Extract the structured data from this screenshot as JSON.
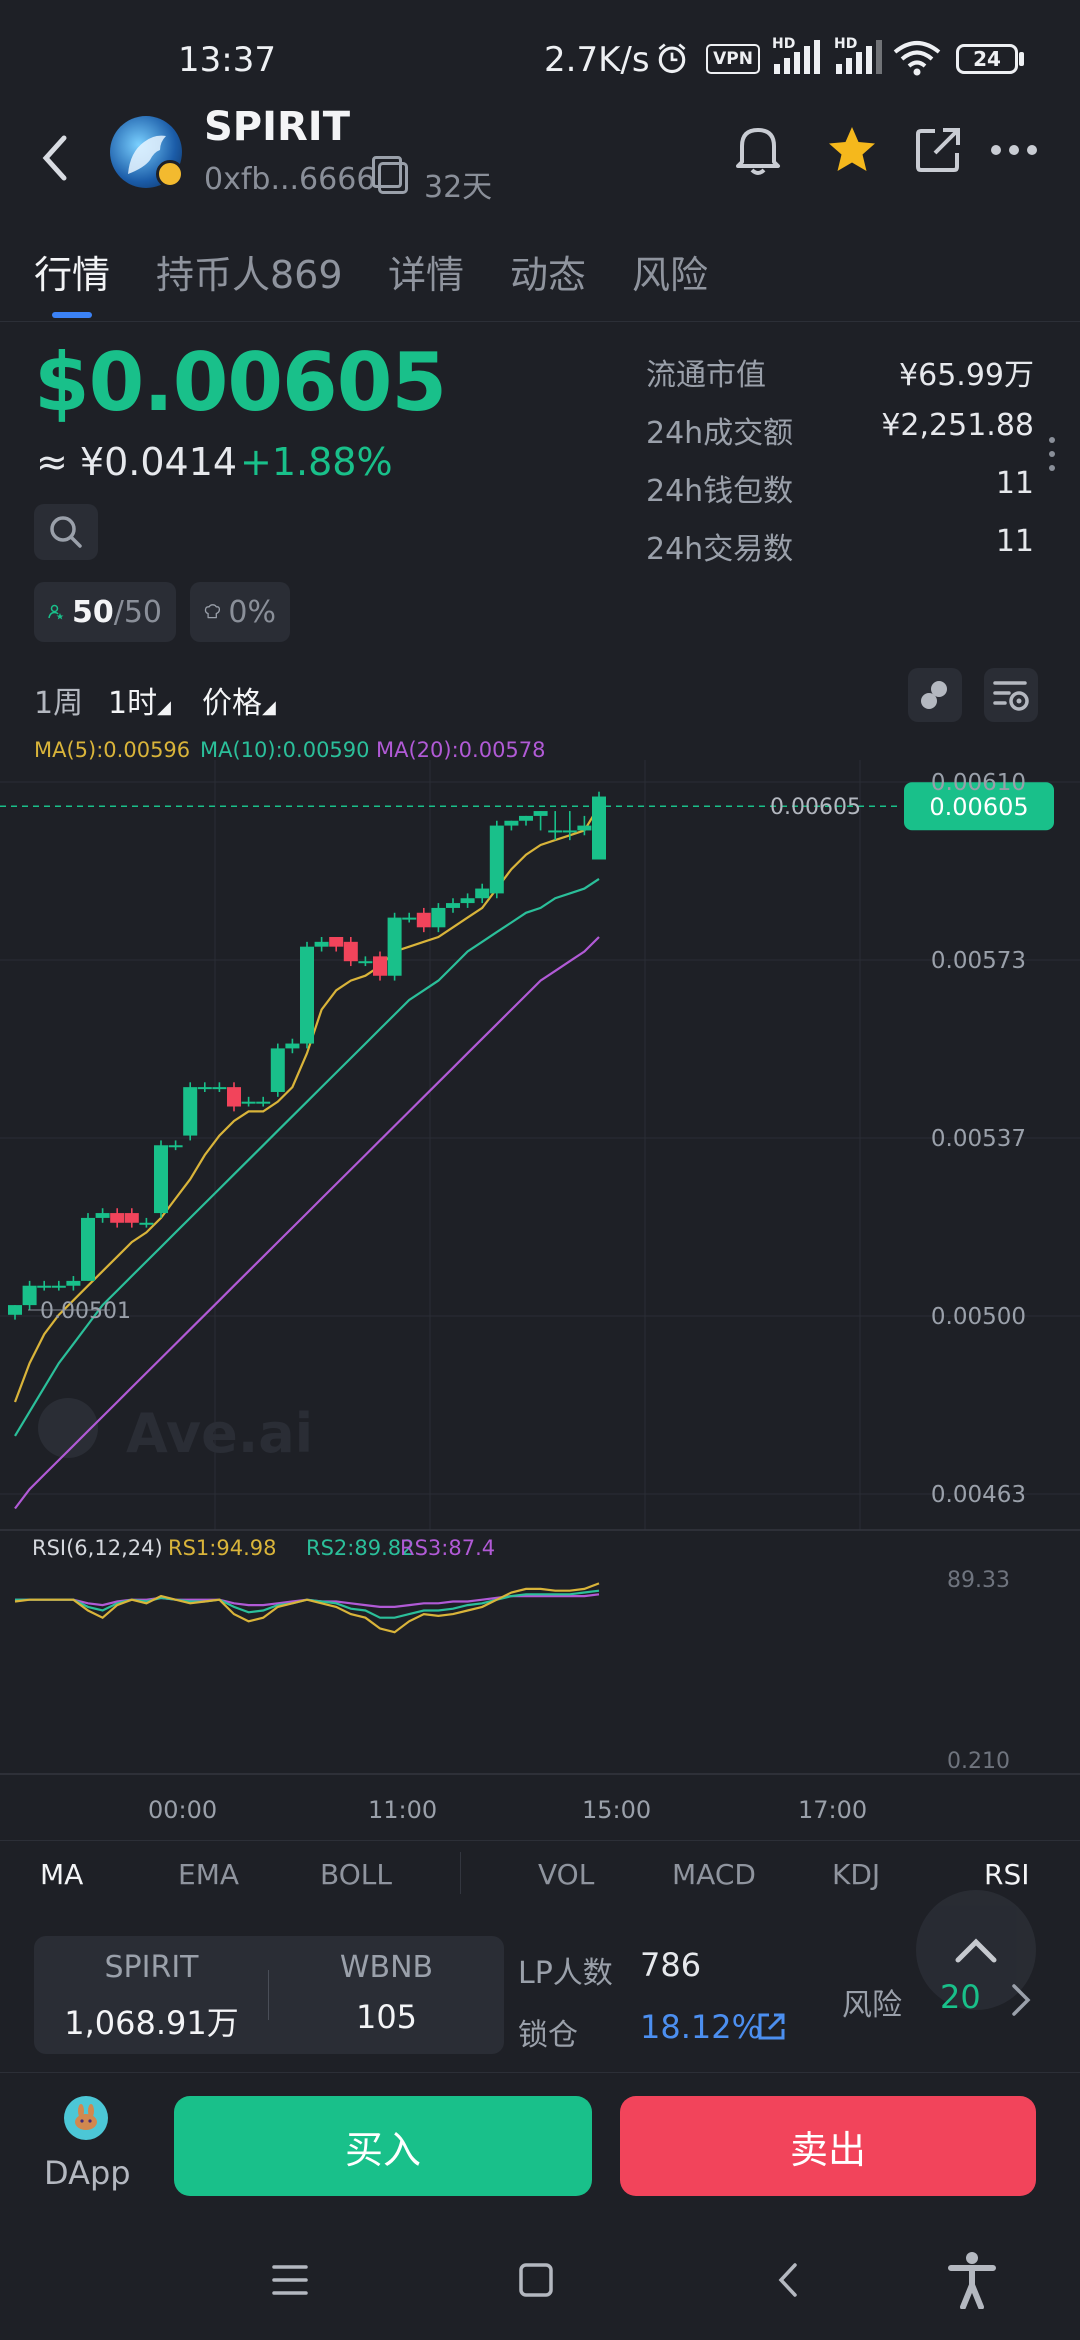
{
  "status_bar": {
    "time": "13:37",
    "network_speed": "2.7K/s",
    "vpn_label": "VPN",
    "hd1": "HD",
    "hd2": "HD",
    "battery": "24"
  },
  "header": {
    "token_name": "SPIRIT",
    "address": "0xfb...6666",
    "age": "32天"
  },
  "tabs": [
    {
      "label": "行情",
      "active": true
    },
    {
      "label": "持币人869",
      "active": false
    },
    {
      "label": "详情",
      "active": false
    },
    {
      "label": "动态",
      "active": false
    },
    {
      "label": "风险",
      "active": false
    }
  ],
  "price": {
    "usd": "$0.00605",
    "cny": "≈ ¥0.0414",
    "change": "+1.88%"
  },
  "stats": [
    {
      "label": "流通市值",
      "value": "¥65.99万"
    },
    {
      "label": "24h成交额",
      "value": "¥2,251.88"
    },
    {
      "label": "24h钱包数",
      "value": "11"
    },
    {
      "label": "24h交易数",
      "value": "11"
    }
  ],
  "chips": {
    "holders_now": "50",
    "holders_total": "/50",
    "tax": "0%"
  },
  "chart_toolbar": {
    "week": "1周",
    "hour": "1时",
    "price": "价格"
  },
  "ma_legend": {
    "ma5": "MA(5):0.00596",
    "ma10": "MA(10):0.00590",
    "ma20": "MA(20):0.00578",
    "ma5_color": "#d9b43a",
    "ma10_color": "#2bbf9a",
    "ma20_color": "#b15ad6"
  },
  "chart_data": {
    "type": "candlestick",
    "y_axis_labels": [
      "0.00610",
      "0.00573",
      "0.00537",
      "0.00500",
      "0.00463"
    ],
    "current_price_label": "0.00605",
    "current_price_line_label": "0.00605",
    "min_label": "0.00501",
    "watermark": "Ave.ai",
    "ylim": [
      0.00463,
      0.0061
    ],
    "up_color": "#19c08a",
    "down_color": "#f2445b",
    "candles": [
      {
        "o": 0.005,
        "h": 0.00502,
        "l": 0.00499,
        "c": 0.00502
      },
      {
        "o": 0.00502,
        "h": 0.00507,
        "l": 0.00501,
        "c": 0.00506
      },
      {
        "o": 0.00506,
        "h": 0.00507,
        "l": 0.00505,
        "c": 0.00506
      },
      {
        "o": 0.00506,
        "h": 0.00507,
        "l": 0.00505,
        "c": 0.00506
      },
      {
        "o": 0.00506,
        "h": 0.00508,
        "l": 0.00505,
        "c": 0.00507
      },
      {
        "o": 0.00507,
        "h": 0.00521,
        "l": 0.00507,
        "c": 0.0052
      },
      {
        "o": 0.0052,
        "h": 0.00522,
        "l": 0.00519,
        "c": 0.00521
      },
      {
        "o": 0.00521,
        "h": 0.00522,
        "l": 0.00518,
        "c": 0.00519
      },
      {
        "o": 0.00521,
        "h": 0.00522,
        "l": 0.00518,
        "c": 0.00519
      },
      {
        "o": 0.00519,
        "h": 0.0052,
        "l": 0.00518,
        "c": 0.00519
      },
      {
        "o": 0.00521,
        "h": 0.00536,
        "l": 0.0052,
        "c": 0.00535
      },
      {
        "o": 0.00535,
        "h": 0.00536,
        "l": 0.00534,
        "c": 0.00535
      },
      {
        "o": 0.00537,
        "h": 0.00548,
        "l": 0.00536,
        "c": 0.00547
      },
      {
        "o": 0.00547,
        "h": 0.00548,
        "l": 0.00546,
        "c": 0.00547
      },
      {
        "o": 0.00547,
        "h": 0.00548,
        "l": 0.00546,
        "c": 0.00547
      },
      {
        "o": 0.00547,
        "h": 0.00548,
        "l": 0.00542,
        "c": 0.00543
      },
      {
        "o": 0.00544,
        "h": 0.00545,
        "l": 0.00543,
        "c": 0.00544
      },
      {
        "o": 0.00544,
        "h": 0.00545,
        "l": 0.00543,
        "c": 0.00544
      },
      {
        "o": 0.00546,
        "h": 0.00556,
        "l": 0.00545,
        "c": 0.00555
      },
      {
        "o": 0.00555,
        "h": 0.00557,
        "l": 0.00554,
        "c": 0.00556
      },
      {
        "o": 0.00556,
        "h": 0.00577,
        "l": 0.00555,
        "c": 0.00576
      },
      {
        "o": 0.00576,
        "h": 0.00578,
        "l": 0.00575,
        "c": 0.00577
      },
      {
        "o": 0.00578,
        "h": 0.00578,
        "l": 0.00575,
        "c": 0.00576
      },
      {
        "o": 0.00577,
        "h": 0.00578,
        "l": 0.00572,
        "c": 0.00573
      },
      {
        "o": 0.00573,
        "h": 0.00574,
        "l": 0.00572,
        "c": 0.00573
      },
      {
        "o": 0.00574,
        "h": 0.00575,
        "l": 0.00569,
        "c": 0.0057
      },
      {
        "o": 0.0057,
        "h": 0.00583,
        "l": 0.00569,
        "c": 0.00582
      },
      {
        "o": 0.00582,
        "h": 0.00583,
        "l": 0.00581,
        "c": 0.00582
      },
      {
        "o": 0.00583,
        "h": 0.00584,
        "l": 0.00579,
        "c": 0.0058
      },
      {
        "o": 0.0058,
        "h": 0.00585,
        "l": 0.00579,
        "c": 0.00584
      },
      {
        "o": 0.00584,
        "h": 0.00586,
        "l": 0.00583,
        "c": 0.00585
      },
      {
        "o": 0.00585,
        "h": 0.00587,
        "l": 0.00584,
        "c": 0.00586
      },
      {
        "o": 0.00586,
        "h": 0.00589,
        "l": 0.00585,
        "c": 0.00588
      },
      {
        "o": 0.00587,
        "h": 0.00602,
        "l": 0.00586,
        "c": 0.00601
      },
      {
        "o": 0.00601,
        "h": 0.00602,
        "l": 0.006,
        "c": 0.00602
      },
      {
        "o": 0.00602,
        "h": 0.00603,
        "l": 0.00601,
        "c": 0.00603
      },
      {
        "o": 0.00603,
        "h": 0.00604,
        "l": 0.006,
        "c": 0.00604
      },
      {
        "o": 0.006,
        "h": 0.00604,
        "l": 0.00598,
        "c": 0.006
      },
      {
        "o": 0.006,
        "h": 0.00604,
        "l": 0.00598,
        "c": 0.006
      },
      {
        "o": 0.006,
        "h": 0.00603,
        "l": 0.00599,
        "c": 0.00601
      },
      {
        "o": 0.00594,
        "h": 0.00608,
        "l": 0.00594,
        "c": 0.00607
      }
    ],
    "ma5": [
      0.00482,
      0.0049,
      0.00496,
      0.005,
      0.00503,
      0.00506,
      0.00509,
      0.00512,
      0.00515,
      0.00517,
      0.0052,
      0.00524,
      0.00528,
      0.00533,
      0.00537,
      0.0054,
      0.00542,
      0.00542,
      0.00544,
      0.00547,
      0.00554,
      0.00563,
      0.00567,
      0.00569,
      0.0057,
      0.00572,
      0.00575,
      0.00576,
      0.00577,
      0.00578,
      0.0058,
      0.00582,
      0.00584,
      0.00588,
      0.00592,
      0.00595,
      0.00597,
      0.00598,
      0.00599,
      0.006,
      0.00605
    ],
    "ma10": [
      0.00475,
      0.0048,
      0.00485,
      0.0049,
      0.00494,
      0.00498,
      0.00502,
      0.00505,
      0.00508,
      0.00511,
      0.00514,
      0.00517,
      0.0052,
      0.00523,
      0.00526,
      0.00529,
      0.00532,
      0.00535,
      0.00538,
      0.00541,
      0.00544,
      0.00547,
      0.0055,
      0.00553,
      0.00556,
      0.00559,
      0.00562,
      0.00565,
      0.00567,
      0.00569,
      0.00572,
      0.00575,
      0.00577,
      0.00579,
      0.00581,
      0.00583,
      0.00584,
      0.00586,
      0.00587,
      0.00588,
      0.0059
    ],
    "ma20": [
      0.0046,
      0.00464,
      0.00467,
      0.0047,
      0.00473,
      0.00476,
      0.00479,
      0.00482,
      0.00485,
      0.00488,
      0.00491,
      0.00494,
      0.00497,
      0.005,
      0.00503,
      0.00506,
      0.00509,
      0.00512,
      0.00515,
      0.00518,
      0.00521,
      0.00524,
      0.00527,
      0.0053,
      0.00533,
      0.00536,
      0.00539,
      0.00542,
      0.00545,
      0.00548,
      0.00551,
      0.00554,
      0.00557,
      0.0056,
      0.00563,
      0.00566,
      0.00569,
      0.00571,
      0.00573,
      0.00575,
      0.00578
    ],
    "rsi_legend": {
      "title": "RSI(6,12,24)",
      "rs1": "RS1:94.98",
      "rs2": "RS2:89.82",
      "rs3": "RS3:87.4",
      "rs1_color": "#d9b43a",
      "rs2_color": "#2bbf9a",
      "rs3_color": "#b15ad6"
    },
    "rsi_axis_labels": [
      "89.33",
      "0.210"
    ],
    "rsi_ylim": [
      0.21,
      100
    ],
    "rsi_rs1": [
      77,
      78,
      78,
      78,
      78,
      72,
      68,
      75,
      78,
      76,
      80,
      78,
      76,
      77,
      78,
      70,
      66,
      68,
      74,
      76,
      78,
      76,
      74,
      70,
      68,
      62,
      60,
      66,
      70,
      69,
      70,
      72,
      74,
      78,
      82,
      84,
      84,
      83,
      83,
      84,
      87
    ],
    "rsi_rs2": [
      78,
      78,
      78,
      78,
      78,
      74,
      72,
      76,
      78,
      77,
      79,
      78,
      77,
      77,
      78,
      74,
      71,
      72,
      75,
      76,
      78,
      77,
      76,
      73,
      72,
      68,
      68,
      70,
      72,
      72,
      73,
      75,
      76,
      78,
      80,
      81,
      81,
      81,
      81,
      82,
      83
    ],
    "rsi_rs3": [
      78,
      78,
      78,
      78,
      78,
      76,
      75,
      77,
      78,
      78,
      79,
      78,
      78,
      78,
      78,
      76,
      75,
      75,
      76,
      77,
      78,
      77,
      77,
      76,
      75,
      74,
      74,
      75,
      76,
      76,
      77,
      77,
      78,
      79,
      80,
      80,
      80,
      80,
      80,
      80,
      81
    ],
    "x_ticks": [
      "00:00",
      "11:00",
      "15:00",
      "17:00"
    ]
  },
  "indicator_tabs": [
    {
      "label": "MA",
      "active": true
    },
    {
      "label": "EMA",
      "active": false
    },
    {
      "label": "BOLL",
      "active": false
    },
    {
      "label": "VOL",
      "active": false
    },
    {
      "label": "MACD",
      "active": false
    },
    {
      "label": "KDJ",
      "active": false
    },
    {
      "label": "RSI",
      "active": true
    }
  ],
  "pool": {
    "token_a": "SPIRIT",
    "token_a_amount": "1,068.91万",
    "token_b": "WBNB",
    "token_b_amount": "105"
  },
  "lp": {
    "lp_label": "LP人数",
    "lp_value": "786",
    "lock_label": "锁仓",
    "lock_value": "18.12%",
    "risk_label": "风险",
    "risk_value": "20"
  },
  "actions": {
    "dapp_label": "DApp",
    "buy_label": "买入",
    "sell_label": "卖出"
  }
}
